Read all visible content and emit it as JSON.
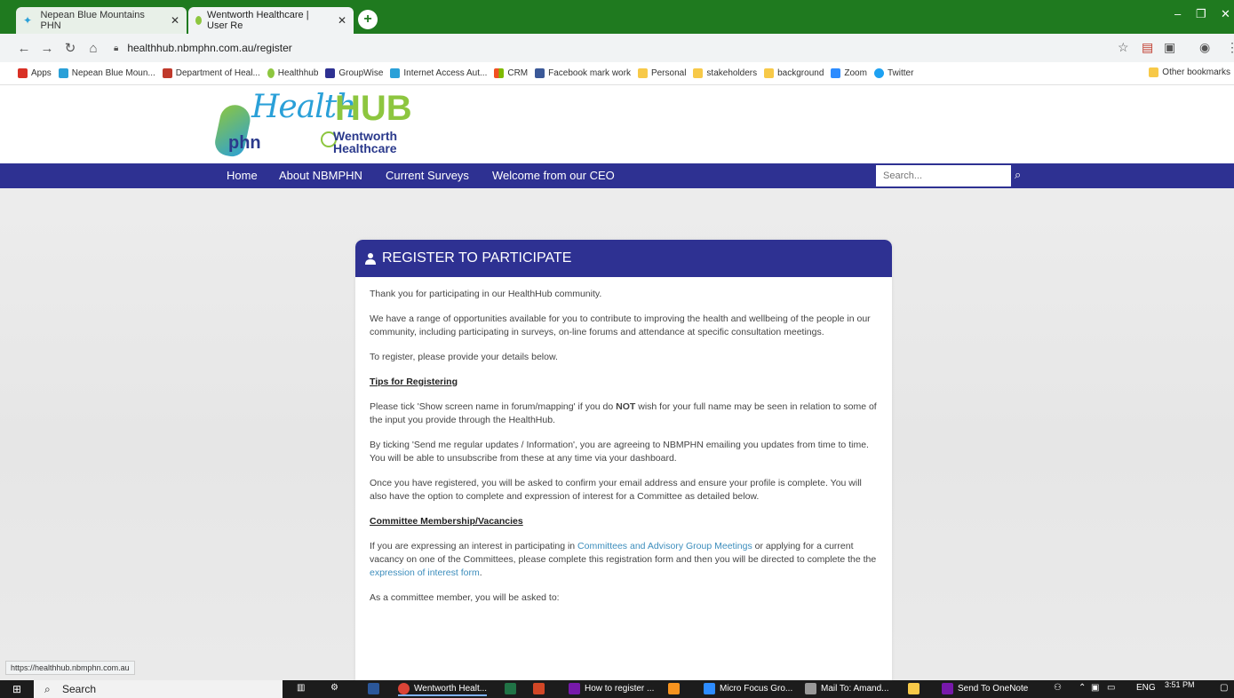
{
  "browser": {
    "tabs": [
      {
        "title": "Nepean Blue Mountains PHN"
      },
      {
        "title": "Wentworth Healthcare | User Re"
      }
    ],
    "url": "healthhub.nbmphn.com.au/register",
    "bookmarks": [
      "Apps",
      "Nepean Blue Moun...",
      "Department of Heal...",
      "Healthhub",
      "GroupWise",
      "Internet Access Aut...",
      "CRM",
      "Facebook mark work",
      "Personal",
      "stakeholders",
      "background",
      "Zoom",
      "Twitter"
    ],
    "other_bookmarks": "Other bookmarks",
    "status_url": "https://healthhub.nbmphn.com.au"
  },
  "site": {
    "logo": {
      "health": "Health",
      "hub": "HUB",
      "phn": "phn",
      "ww1": "Wentworth",
      "ww2": "Healthcare"
    },
    "nav": [
      "Home",
      "About NBMPHN",
      "Current Surveys",
      "Welcome from our CEO"
    ],
    "search_placeholder": "Search..."
  },
  "register": {
    "title": "REGISTER TO PARTICIPATE",
    "p1": "Thank you for participating in our HealthHub community.",
    "p2": "We have a range of opportunities available for you to contribute to improving the health and wellbeing of the people in our community, including participating in surveys, on-line forums and attendance at specific consultation meetings.",
    "p3": "To register, please provide your details below.",
    "tips_heading": "Tips for Registering",
    "p4a": "Please tick 'Show screen name in forum/mapping' if you do ",
    "p4b": "NOT",
    "p4c": " wish for your full name may be seen in relation to some of the input you provide through the HealthHub.",
    "p5": "By ticking 'Send me regular updates / Information', you are agreeing to NBMPHN emailing you updates from time to time. You will be able to unsubscribe from these at any time via your dashboard.",
    "p6": "Once you have registered, you will be asked to confirm your email address and ensure your profile is complete. You will also have the option to complete and expression of interest for a Committee as detailed below.",
    "committee_heading": "Committee Membership/Vacancies",
    "p7a": "If you are expressing an interest in participating in ",
    "p7link1": "Committees and Advisory Group Meetings",
    "p7b": " or applying for a current vacancy on one of the Committees, please complete this registration form and then you will be directed to complete the the ",
    "p7link2": "expression of interest form",
    "p7c": ".",
    "p8": "As a committee member, you will be asked to:"
  },
  "taskbar": {
    "search": "Search",
    "items": [
      "Wentworth Healt...",
      "How to register ...",
      "Micro Focus Gro...",
      "Mail To: Amand...",
      "Send To OneNote"
    ],
    "lang": "ENG",
    "time": "3:51 PM"
  }
}
